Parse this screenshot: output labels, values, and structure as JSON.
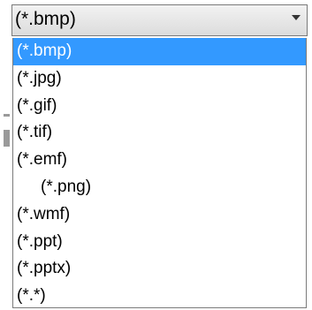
{
  "combo": {
    "selected_value": "(*.bmp)"
  },
  "options": [
    "(*.bmp)",
    "(*.jpg)",
    "(*.gif)",
    "(*.tif)",
    "(*.emf)",
    "(*.png)",
    "(*.wmf)",
    "(*.ppt)",
    "(*.pptx)",
    "(*.*)"
  ],
  "colors": {
    "highlight": "#3399ff",
    "highlight_text": "#ffffff"
  }
}
